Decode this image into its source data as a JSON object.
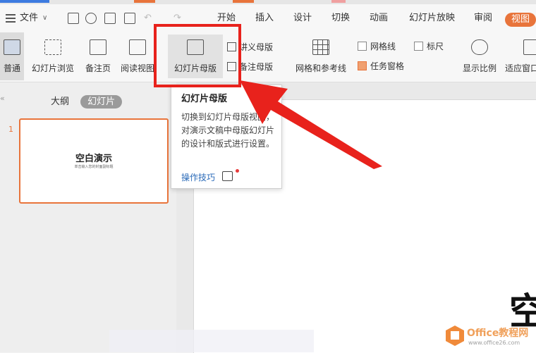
{
  "menubar": {
    "file": "文件",
    "tabs": [
      "开始",
      "插入",
      "设计",
      "切换",
      "动画",
      "幻灯片放映",
      "审阅"
    ],
    "active_tab": "视图"
  },
  "ribbon": {
    "normal": "普通",
    "slide_browse": "幻灯片浏览",
    "notes_page": "备注页",
    "reading_view": "阅读视图",
    "slide_master": "幻灯片母版",
    "handout_master": "讲义母版",
    "notes_master": "备注母版",
    "grid_guides": "网格和参考线",
    "gridlines": "网格线",
    "ruler": "标尺",
    "task_pane": "任务窗格",
    "zoom": "显示比例",
    "fit_window": "适应窗口"
  },
  "left_panel": {
    "tab_outline": "大纲",
    "tab_slides": "幻灯片",
    "slide_number": "1",
    "thumb_title": "空白演示",
    "thumb_subtitle": "单击输入您的封面副标题"
  },
  "tooltip": {
    "title": "幻灯片母版",
    "body": "切换到幻灯片母版视图，对演示文稿中母版幻灯片的设计和版式进行设置。",
    "link": "操作技巧"
  },
  "canvas": {
    "partial_text": "空"
  },
  "watermark": {
    "brand": "Office教程网",
    "url": "www.office26.com"
  },
  "colors": {
    "accent": "#e8743b",
    "highlight_red": "#e8221c",
    "link_blue": "#2a6ab8"
  }
}
